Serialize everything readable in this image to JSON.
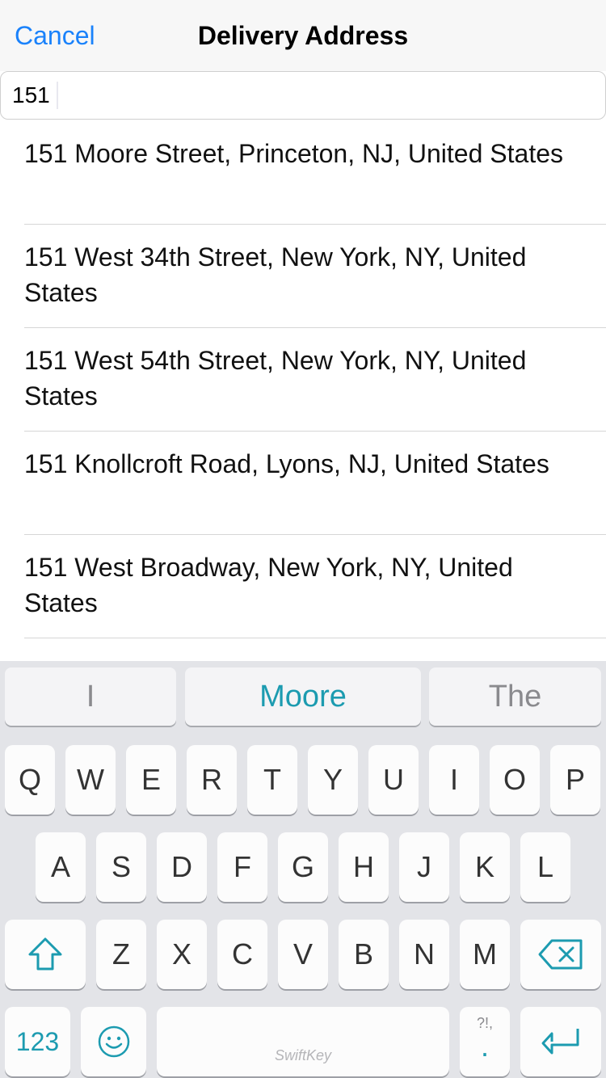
{
  "nav": {
    "cancel_label": "Cancel",
    "title": "Delivery Address"
  },
  "search": {
    "value": "151"
  },
  "results": [
    "151 Moore Street, Princeton, NJ, United States",
    "151 West 34th Street, New York, NY, United States",
    "151 West 54th Street, New York, NY, United States",
    "151 Knollcroft Road, Lyons, NJ, United States",
    "151 West Broadway, New York, NY, United States"
  ],
  "keyboard": {
    "predictions": [
      "I",
      "Moore",
      "The"
    ],
    "row1": [
      "Q",
      "W",
      "E",
      "R",
      "T",
      "Y",
      "U",
      "I",
      "O",
      "P"
    ],
    "row2": [
      "A",
      "S",
      "D",
      "F",
      "G",
      "H",
      "J",
      "K",
      "L"
    ],
    "row3": [
      "Z",
      "X",
      "C",
      "V",
      "B",
      "N",
      "M"
    ],
    "numbers_label": "123",
    "space_brand": "SwiftKey",
    "punct_top": "?!,",
    "punct_main": ".",
    "icons": {
      "shift": "shift-icon",
      "backspace": "backspace-icon",
      "emoji": "emoji-icon",
      "return": "return-icon"
    },
    "accent_color": "#1c9bb0"
  }
}
